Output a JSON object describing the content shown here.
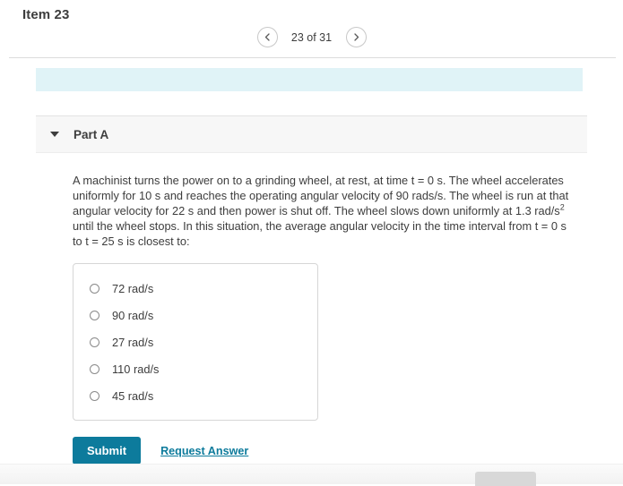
{
  "header": {
    "item_title": "Item 23",
    "pager": {
      "prev_icon": "chevron-left-icon",
      "next_icon": "chevron-right-icon",
      "label": "23 of 31",
      "current": 23,
      "total": 31
    }
  },
  "banner": {
    "text": ""
  },
  "part": {
    "caret_icon": "caret-down-icon",
    "label": "Part A",
    "question": {
      "line1": "A machinist turns the power on to a grinding wheel, at rest, at time t = 0 s. The wheel accelerates",
      "line2": "uniformly for 10 s and reaches the operating angular velocity of 90 rads/s. The wheel is run at that",
      "line3_a": "angular velocity for 22 s and then power is shut off. The wheel slows down uniformly at 1.3 rad/s",
      "line3_sup": "2",
      "line4": "until the wheel stops. In this situation, the average angular velocity in the time interval from t = 0 s",
      "line5": "to t = 25 s is closest to:"
    },
    "options": [
      {
        "label": "72 rad/s",
        "selected": false
      },
      {
        "label": "90 rad/s",
        "selected": false
      },
      {
        "label": "27 rad/s",
        "selected": false
      },
      {
        "label": "110 rad/s",
        "selected": false
      },
      {
        "label": "45 rad/s",
        "selected": false
      }
    ],
    "submit_label": "Submit",
    "request_answer_label": "Request Answer"
  },
  "footer": {
    "button_label": ""
  },
  "colors": {
    "accent_teal": "#0d7b9c",
    "banner_cyan": "#e0f3f7",
    "part_header_grey": "#f7f7f7",
    "text_dark": "#3d3d3d",
    "border_grey": "#d6d6d6"
  }
}
